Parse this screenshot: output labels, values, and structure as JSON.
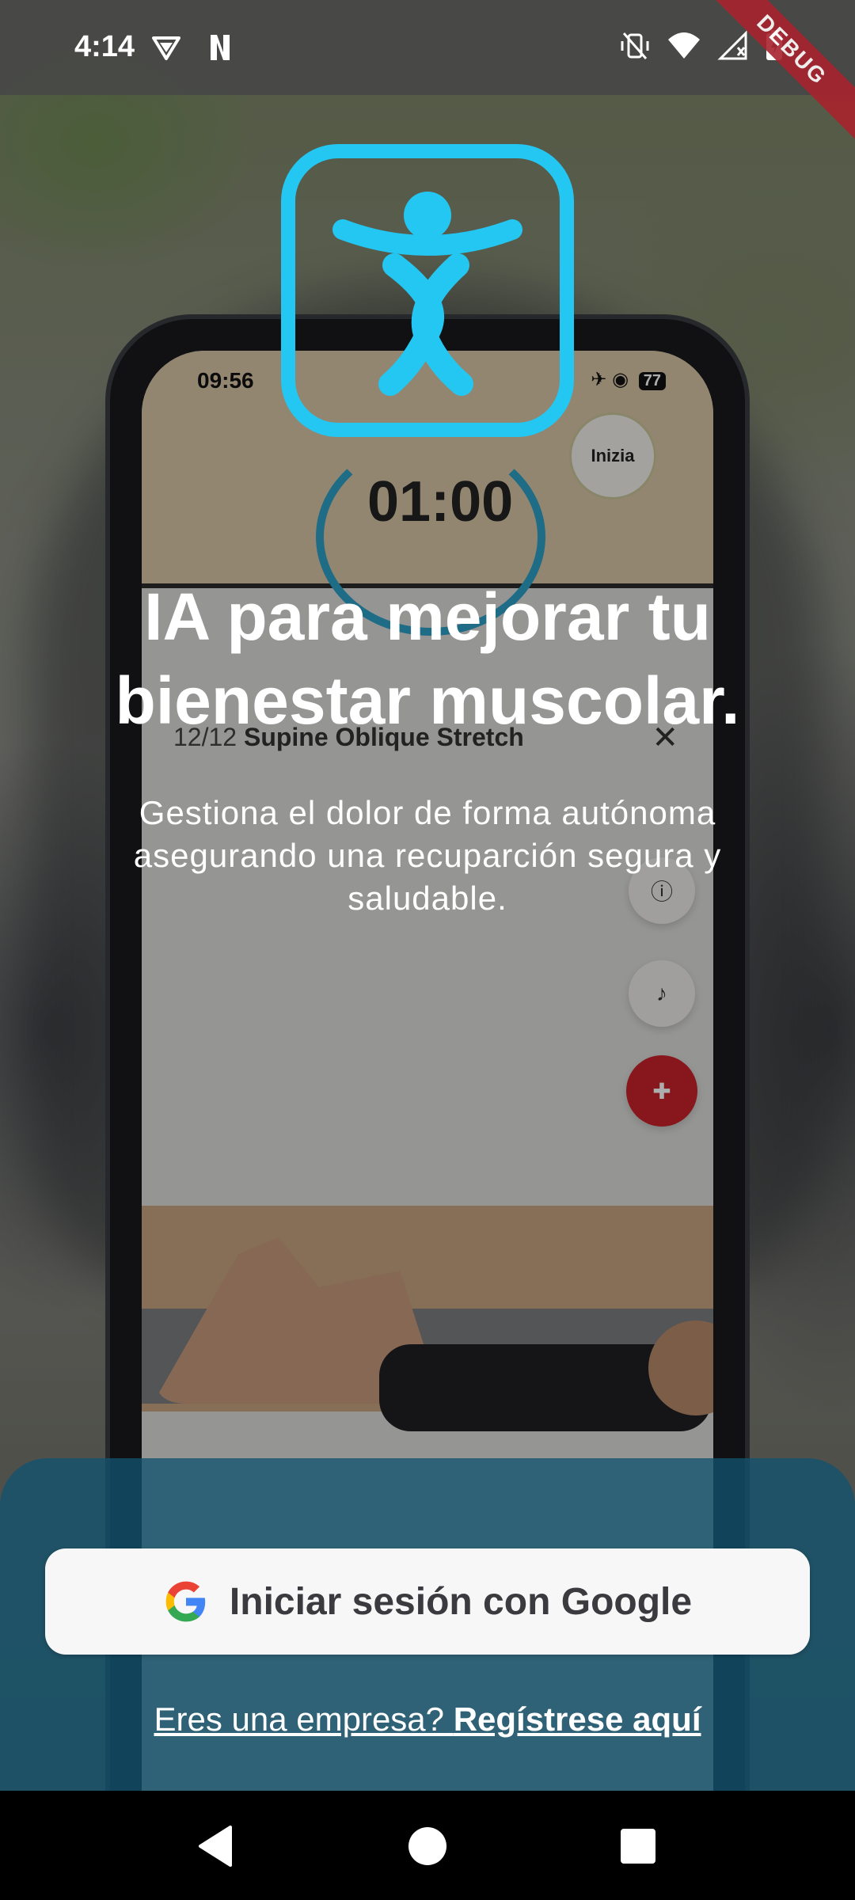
{
  "status_bar": {
    "time": "4:14",
    "debug_label": "DEBUG"
  },
  "phone_mockup": {
    "time": "09:56",
    "battery": "77",
    "timer": "01:00",
    "start_button": "Inizia",
    "exercise_index": "12/12",
    "exercise_name": "Supine Oblique Stretch"
  },
  "hero": {
    "headline": "IA para mejorar tu bienestar muscolar.",
    "subtext": "Gestiona el dolor de forma autónoma asegurando una recuparción segura y saludable."
  },
  "actions": {
    "google_button": "Iniciar sesión con Google",
    "register_prefix": "Eres una empresa?",
    "register_link": "Regístrese aquí"
  },
  "colors": {
    "accent": "#24c6f2",
    "panel": "#12536e",
    "debug": "#a8232e"
  }
}
